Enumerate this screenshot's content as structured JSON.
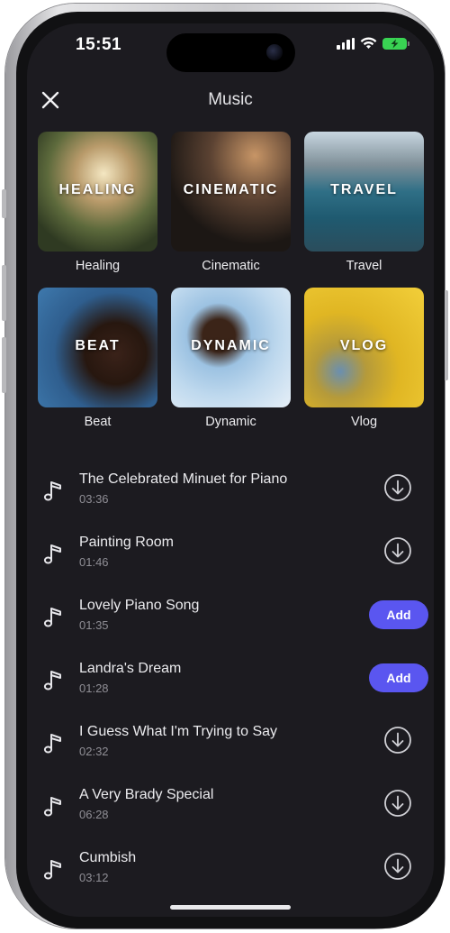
{
  "status_bar": {
    "time": "15:51"
  },
  "header": {
    "title": "Music"
  },
  "genres": [
    {
      "overlay": "HEALING",
      "label": "Healing"
    },
    {
      "overlay": "CINEMATIC",
      "label": "Cinematic"
    },
    {
      "overlay": "TRAVEL",
      "label": "Travel"
    },
    {
      "overlay": "BEAT",
      "label": "Beat"
    },
    {
      "overlay": "DYNAMIC",
      "label": "Dynamic"
    },
    {
      "overlay": "VLOG",
      "label": "Vlog"
    }
  ],
  "tracks": [
    {
      "name": "The Celebrated Minuet for Piano",
      "duration": "03:36",
      "action": "download"
    },
    {
      "name": "Painting Room",
      "duration": "01:46",
      "action": "download"
    },
    {
      "name": "Lovely Piano Song",
      "duration": "01:35",
      "action": "add",
      "action_label": "Add"
    },
    {
      "name": "Landra's Dream",
      "duration": "01:28",
      "action": "add",
      "action_label": "Add"
    },
    {
      "name": "I Guess What I'm Trying to Say",
      "duration": "02:32",
      "action": "download"
    },
    {
      "name": "A Very Brady Special",
      "duration": "06:28",
      "action": "download"
    },
    {
      "name": "Cumbish",
      "duration": "03:12",
      "action": "download"
    }
  ],
  "colors": {
    "background": "#1c1b20",
    "accent": "#5a56f0",
    "text": "#ebebee",
    "muted": "#8f8e95"
  },
  "icons": [
    "close-icon",
    "music-note-icon",
    "download-icon",
    "signal-icon",
    "wifi-icon",
    "battery-charging-icon"
  ]
}
